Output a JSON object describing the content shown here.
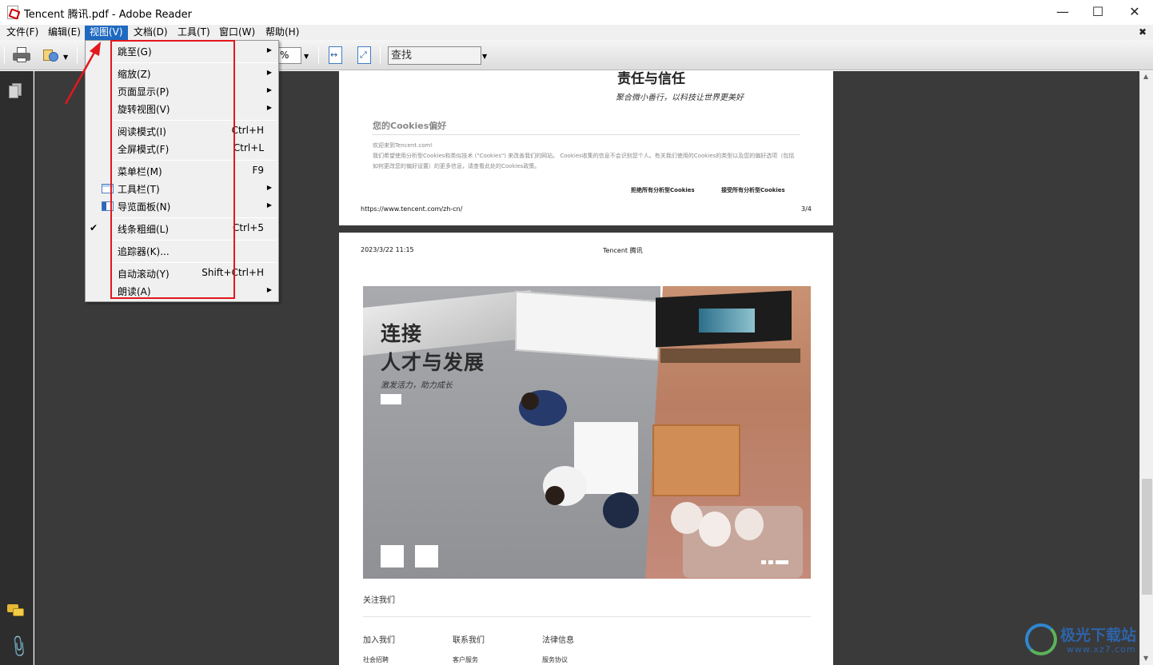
{
  "window": {
    "title": "Tencent 腾讯.pdf - Adobe Reader",
    "minimize_glyph": "—",
    "maximize_glyph": "☐",
    "close_glyph": "✕"
  },
  "menubar": {
    "items": [
      "文件(F)",
      "编辑(E)",
      "视图(V)",
      "文档(D)",
      "工具(T)",
      "窗口(W)",
      "帮助(H)"
    ],
    "active_index": 2,
    "close_glyph": "✖"
  },
  "toolbar": {
    "zoom_value": "%",
    "search_placeholder": "查找",
    "dropdown_glyph": "▼"
  },
  "view_menu": {
    "items": [
      {
        "label": "跳至(G)",
        "shortcut": "",
        "submenu": true
      },
      {
        "label": "缩放(Z)",
        "shortcut": "",
        "submenu": true
      },
      {
        "label": "页面显示(P)",
        "shortcut": "",
        "submenu": true
      },
      {
        "label": "旋转视图(V)",
        "shortcut": "",
        "submenu": true
      },
      {
        "label": "阅读模式(I)",
        "shortcut": "Ctrl+H",
        "submenu": false
      },
      {
        "label": "全屏模式(F)",
        "shortcut": "Ctrl+L",
        "submenu": false
      },
      {
        "label": "菜单栏(M)",
        "shortcut": "F9",
        "submenu": false
      },
      {
        "label": "工具栏(T)",
        "shortcut": "",
        "submenu": true,
        "icon": "toolbar-icon"
      },
      {
        "label": "导览面板(N)",
        "shortcut": "",
        "submenu": true,
        "icon": "navigation-pane-icon"
      },
      {
        "label": "线条粗细(L)",
        "shortcut": "Ctrl+5",
        "submenu": false,
        "checked": true
      },
      {
        "label": "追踪器(K)...",
        "shortcut": "",
        "submenu": false
      },
      {
        "label": "自动滚动(Y)",
        "shortcut": "Shift+Ctrl+H",
        "submenu": false
      },
      {
        "label": "朗读(A)",
        "shortcut": "",
        "submenu": true
      }
    ],
    "submenu_glyph": "▶",
    "check_glyph": "✔"
  },
  "document": {
    "page1": {
      "heading": "责任与信任",
      "slogan": "聚合微小善行，以科技让世界更美好",
      "cookie_title": "您的Cookies偏好",
      "cookie_body": [
        "欢迎来到Tencent.com!",
        "我们希望使用分析型Cookies和类似技术 (\"Cookies\") 来改善我们的网站。 Cookies收集的信息不会识别您个人。有关我们使用的Cookies的类型以及您的偏好选项（包括",
        "如何更改您的偏好设置）的更多信息，请查看此处的Cookies政策。"
      ],
      "reject_button": "拒绝所有分析型Cookies",
      "accept_button": "接受所有分析型Cookies",
      "url": "https://www.tencent.com/zh-cn/",
      "page_number": "3/4"
    },
    "page2": {
      "date": "2023/3/22 11:15",
      "site_title": "Tencent 腾讯",
      "hero_title_line1": "连接",
      "hero_title_line2": "人才与发展",
      "hero_subtitle": "激发活力，助力成长",
      "follow_us": "关注我们",
      "columns": [
        "加入我们",
        "联系我们",
        "法律信息"
      ],
      "column_links": [
        "社会招聘",
        "客户服务",
        "服务协议"
      ]
    }
  },
  "watermark": {
    "text": "极光下载站",
    "url": "www.xz7.com"
  },
  "colors": {
    "menu_active": "#1f6ac0",
    "highlight_red": "#e3171c",
    "doc_background": "#3a3a3a"
  }
}
